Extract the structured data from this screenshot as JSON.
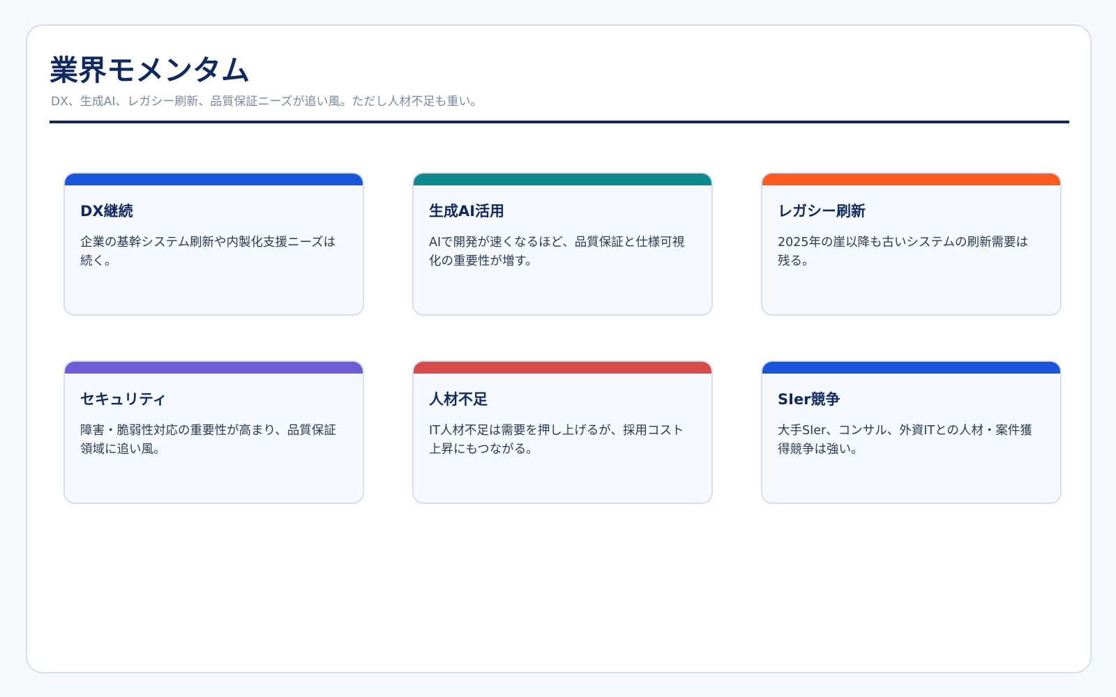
{
  "page": {
    "title": "業界モメンタム",
    "subtitle": "DX、生成AI、レガシー刷新、品質保証ニーズが追い風。ただし人材不足も重い。"
  },
  "cards": [
    {
      "title": "DX継続",
      "text": "企業の基幹システム刷新や内製化支援ニーズは続く。",
      "color": "#1a56db"
    },
    {
      "title": "生成AI活用",
      "text": "AIで開発が速くなるほど、品質保証と仕様可視化の重要性が増す。",
      "color": "#0e8a8f"
    },
    {
      "title": "レガシー刷新",
      "text": "2025年の崖以降も古いシステムの刷新需要は残る。",
      "color": "#ff5a1f"
    },
    {
      "title": "セキュリティ",
      "text": "障害・脆弱性対応の重要性が高まり、品質保証領域に追い風。",
      "color": "#6e5bd6"
    },
    {
      "title": "人材不足",
      "text": "IT人材不足は需要を押し上げるが、採用コスト上昇にもつながる。",
      "color": "#d94b4b"
    },
    {
      "title": "SIer競争",
      "text": "大手SIer、コンサル、外資ITとの人材・案件獲得競争は強い。",
      "color": "#1a56db"
    }
  ]
}
